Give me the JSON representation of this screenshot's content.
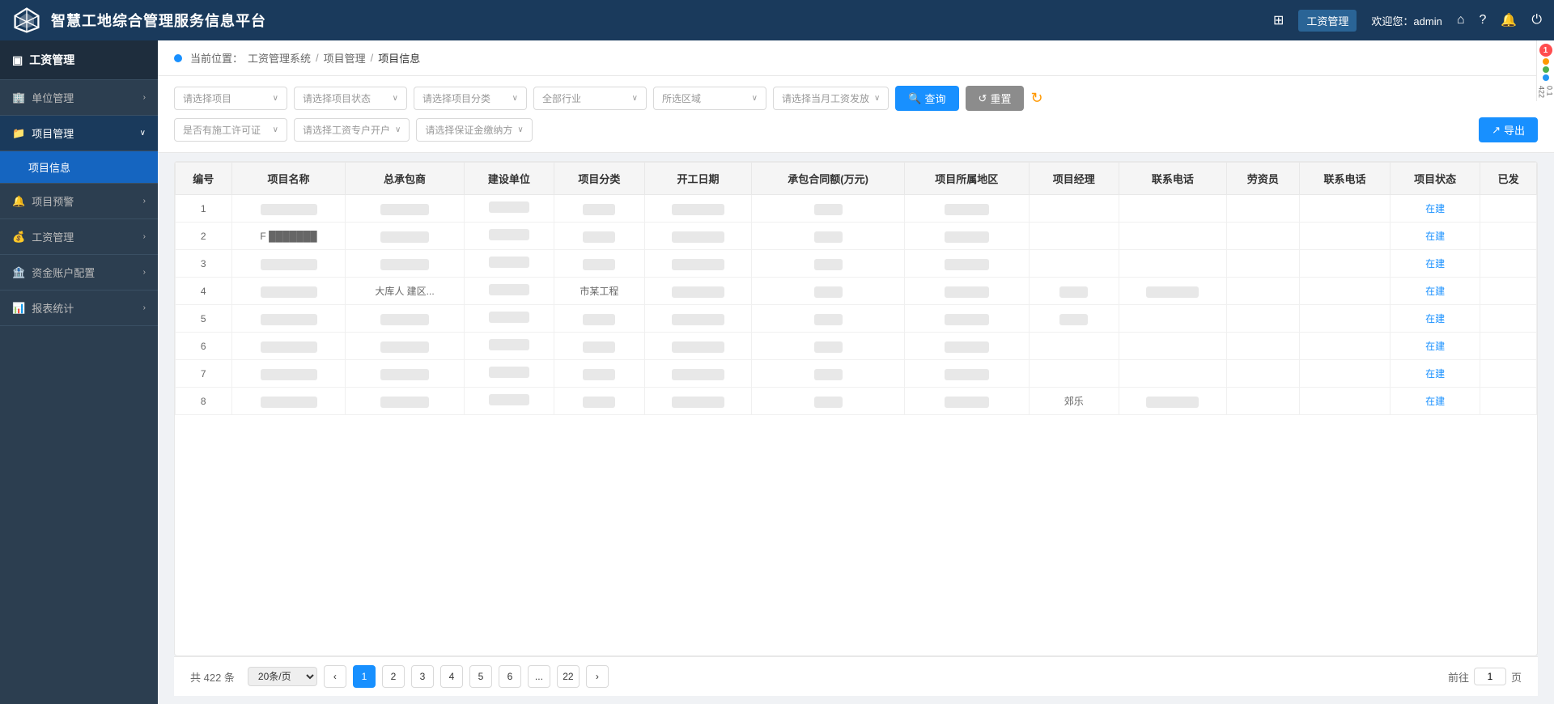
{
  "header": {
    "logo_text": "智慧工地综合管理服务信息平台",
    "module_name": "工资管理",
    "welcome": "欢迎您：admin"
  },
  "sidebar": {
    "header_label": "工资管理",
    "items": [
      {
        "id": "unit",
        "label": "单位管理",
        "icon": "building",
        "expanded": false
      },
      {
        "id": "project",
        "label": "项目管理",
        "icon": "folder",
        "expanded": true
      },
      {
        "id": "project-info",
        "label": "项目信息",
        "is_sub": true,
        "active": true
      },
      {
        "id": "project-warning",
        "label": "项目预警",
        "icon": "bell",
        "expanded": false
      },
      {
        "id": "wage-mgmt",
        "label": "工资管理",
        "icon": "money",
        "expanded": false
      },
      {
        "id": "fund-account",
        "label": "资金账户配置",
        "icon": "bank",
        "expanded": false
      },
      {
        "id": "report-stats",
        "label": "报表统计",
        "icon": "chart",
        "expanded": false
      }
    ]
  },
  "breadcrumb": {
    "system": "工资管理系统",
    "section": "项目管理",
    "current": "项目信息"
  },
  "filters": {
    "row1": [
      {
        "id": "project",
        "placeholder": "请选择项目"
      },
      {
        "id": "project-status",
        "placeholder": "请选择项目状态"
      },
      {
        "id": "project-category",
        "placeholder": "请选择项目分类"
      },
      {
        "id": "industry",
        "placeholder": "全部行业"
      },
      {
        "id": "region",
        "placeholder": "所选区域"
      },
      {
        "id": "salary-month",
        "placeholder": "请选择当月工资发放"
      }
    ],
    "row2": [
      {
        "id": "construction-permit",
        "placeholder": "是否有施工许可证"
      },
      {
        "id": "wage-account",
        "placeholder": "请选择工资专户开户"
      },
      {
        "id": "guarantee",
        "placeholder": "请选择保证金缴纳方"
      }
    ],
    "btn_query": "查询",
    "btn_reset": "重置",
    "btn_export": "导出"
  },
  "table": {
    "columns": [
      "编号",
      "项目名称",
      "总承包商",
      "建设单位",
      "项目分类",
      "开工日期",
      "承包合同额(万元)",
      "项目所属地区",
      "项目经理",
      "联系电话",
      "劳资员",
      "联系电话",
      "项目状态",
      "已发"
    ],
    "rows": [
      {
        "id": 1,
        "project_name": "██████",
        "contractor": "████████",
        "owner": "",
        "category": "██████",
        "start_date": "████████",
        "contract_amount": "████",
        "region": "████...",
        "pm": "",
        "pm_phone": "",
        "labor": "",
        "labor_phone": "",
        "status": "在建",
        "paid": ""
      },
      {
        "id": 2,
        "project_name": "F ███████",
        "contractor": "████████",
        "owner": "",
        "category": "████",
        "start_date": "████████",
        "contract_amount": "████",
        "region": "████...",
        "pm": "",
        "pm_phone": "",
        "labor": "",
        "labor_phone": "",
        "status": "在建",
        "paid": ""
      },
      {
        "id": 3,
        "project_name": "███████",
        "contractor": "████████",
        "owner": "",
        "category": "████",
        "start_date": "████████",
        "contract_amount": "████",
        "region": "████",
        "pm": "",
        "pm_phone": "",
        "labor": "",
        "labor_phone": "",
        "status": "在建",
        "paid": ""
      },
      {
        "id": 4,
        "project_name": "███████",
        "contractor": "大库人 建区...",
        "owner": "",
        "category": "市某工程",
        "start_date": "████████",
        "contract_amount": "████",
        "region": "████",
        "pm": "████",
        "pm_phone": "████████",
        "labor": "",
        "labor_phone": "",
        "status": "在建",
        "paid": ""
      },
      {
        "id": 5,
        "project_name": "███████",
        "contractor": "████████",
        "owner": "",
        "category": "████",
        "start_date": "████████",
        "contract_amount": "████",
        "region": "████",
        "pm": "█...",
        "pm_phone": "",
        "labor": "",
        "labor_phone": "",
        "status": "在建",
        "paid": ""
      },
      {
        "id": 6,
        "project_name": "███████",
        "contractor": "████████",
        "owner": "",
        "category": "████",
        "start_date": "████████",
        "contract_amount": "████",
        "region": "█...",
        "pm": "",
        "pm_phone": "",
        "labor": "",
        "labor_phone": "",
        "status": "在建",
        "paid": ""
      },
      {
        "id": 7,
        "project_name": "███████",
        "contractor": "████████",
        "owner": "",
        "category": "████",
        "start_date": "████████",
        "contract_amount": "████",
        "region": "████",
        "pm": "",
        "pm_phone": "",
        "labor": "",
        "labor_phone": "",
        "status": "在建",
        "paid": ""
      },
      {
        "id": 8,
        "project_name": "███████",
        "contractor": "████████",
        "owner": "",
        "category": "████",
        "start_date": "████████",
        "contract_amount": "████",
        "region": "████",
        "pm": "郊乐",
        "pm_phone": "████████",
        "labor": "",
        "labor_phone": "",
        "status": "在建",
        "paid": ""
      }
    ]
  },
  "pagination": {
    "total_label": "共 422 条",
    "page_size": "20条/页",
    "pages": [
      "1",
      "2",
      "3",
      "4",
      "5",
      "6",
      "...",
      "22"
    ],
    "current_page": "1",
    "goto_label": "前往",
    "page_unit": "页"
  },
  "right_panel": {
    "badge": "1",
    "colors": [
      "#ff9800",
      "#4caf50",
      "#2196f3"
    ],
    "count": "422"
  }
}
